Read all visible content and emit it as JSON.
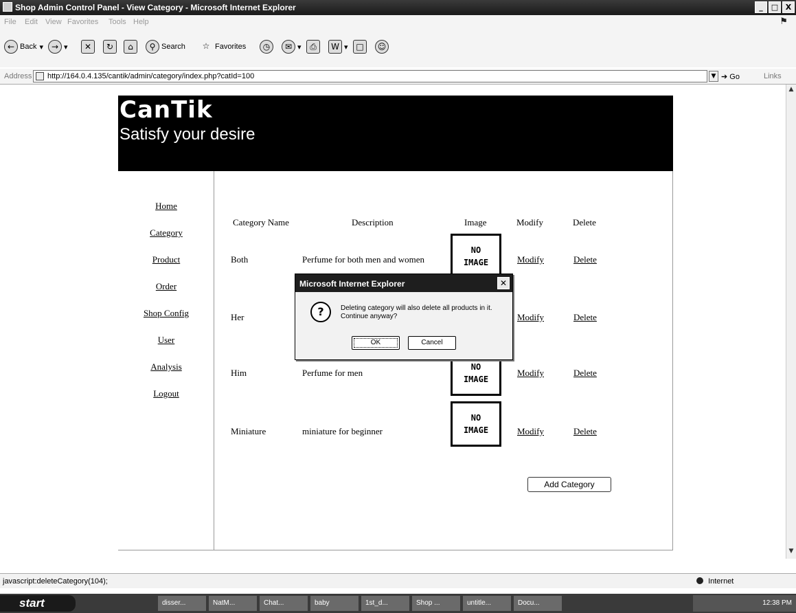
{
  "window": {
    "title": "Shop Admin Control Panel - View Category - Microsoft Internet Explorer",
    "controls": [
      "_",
      "□",
      "X"
    ]
  },
  "menu": {
    "items": [
      "File",
      "Edit",
      "View",
      "Favorites",
      "Tools",
      "Help"
    ]
  },
  "toolbar": {
    "back_label": "Back",
    "search_label": "Search",
    "favorites_label": "Favorites"
  },
  "address": {
    "label": "Address",
    "url": "http://164.0.4.135/cantik/admin/category/index.php?catId=100",
    "go_label": "Go",
    "links_label": "Links"
  },
  "site": {
    "logo": "CanTik",
    "tagline": "Satisfy your desire"
  },
  "nav": {
    "items": [
      "Home",
      "Category",
      "Product",
      "Order",
      "Shop Config",
      "User",
      "Analysis",
      "Logout"
    ]
  },
  "table": {
    "headers": [
      "Category Name",
      "Description",
      "Image",
      "Modify",
      "Delete"
    ],
    "rows": [
      {
        "name": "Both",
        "description": "Perfume for both men and women",
        "image": "NO IMAGE",
        "modify": "Modify",
        "delete": "Delete"
      },
      {
        "name": "Her",
        "description": "",
        "image": "NO IMAGE",
        "modify": "Modify",
        "delete": "Delete"
      },
      {
        "name": "Him",
        "description": "Perfume for men",
        "image": "NO IMAGE",
        "modify": "Modify",
        "delete": "Delete"
      },
      {
        "name": "Miniature",
        "description": "miniature for beginner",
        "image": "NO IMAGE",
        "modify": "Modify",
        "delete": "Delete"
      }
    ],
    "no_image_line1": "NO",
    "no_image_line2": "IMAGE"
  },
  "add_button_label": "Add Category",
  "dialog": {
    "title": "Microsoft Internet Explorer",
    "message_line1": "Deleting category will also delete all products in it.",
    "message_line2": "Continue anyway?",
    "ok_label": "OK",
    "cancel_label": "Cancel",
    "icon": "question-icon"
  },
  "status": {
    "text": "javascript:deleteCategory(104);",
    "zone": "Internet"
  },
  "taskbar": {
    "start_label": "start",
    "tasks": [
      "disser...",
      "NatM...",
      "Chat...",
      "baby",
      "1st_d...",
      "Shop ...",
      "untitle...",
      "Docu..."
    ],
    "clock": "12:38 PM"
  }
}
